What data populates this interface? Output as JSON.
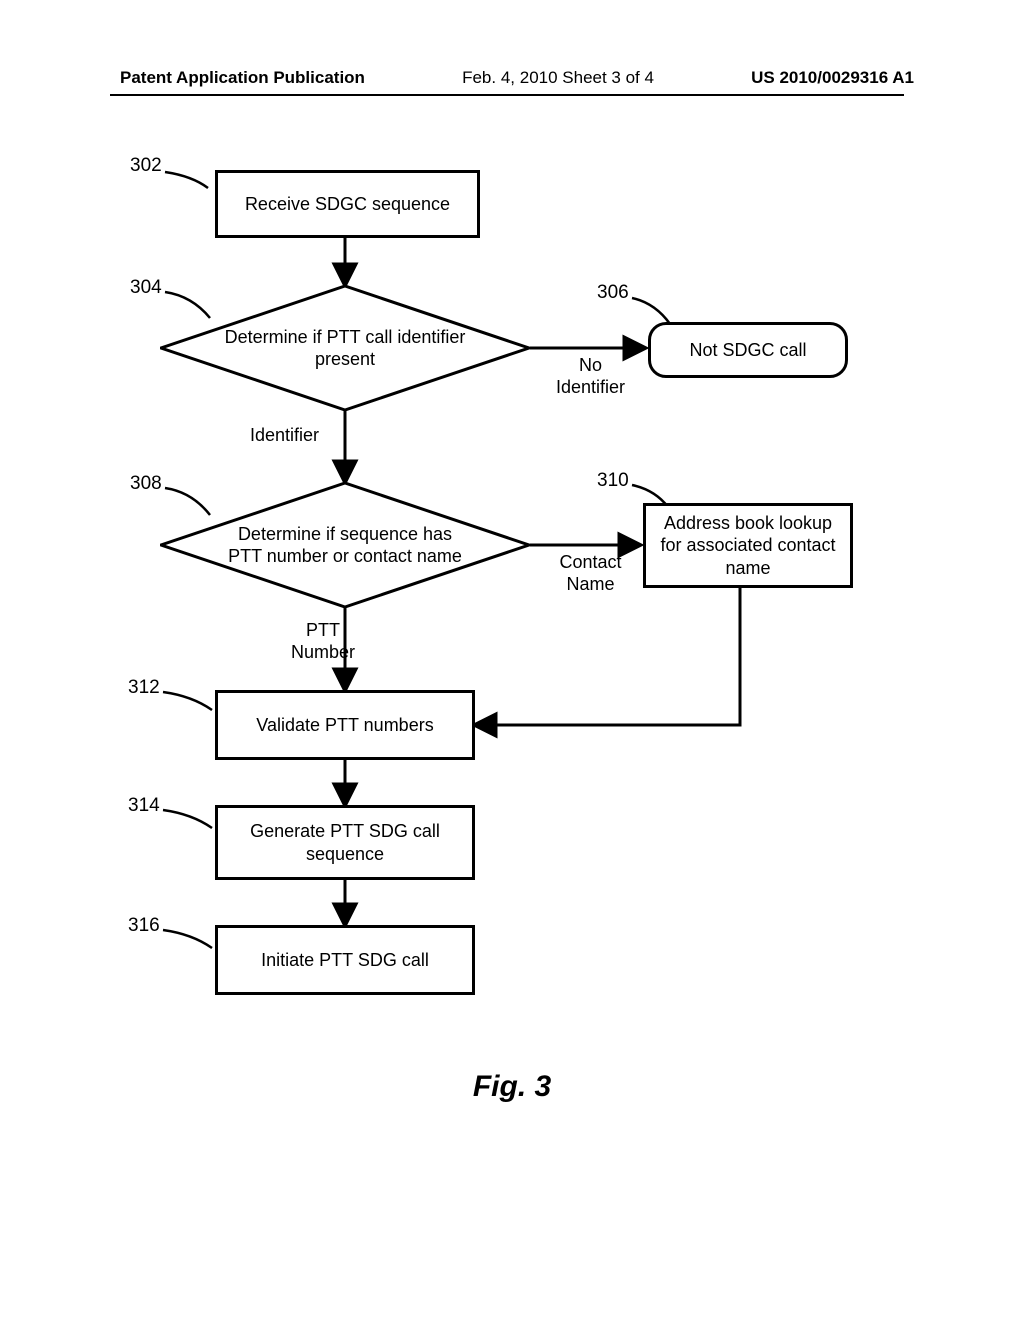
{
  "header": {
    "left": "Patent Application Publication",
    "mid": "Feb. 4, 2010  Sheet 3 of 4",
    "right": "US 2010/0029316 A1"
  },
  "refs": {
    "r302": "302",
    "r304": "304",
    "r306": "306",
    "r308": "308",
    "r310": "310",
    "r312": "312",
    "r314": "314",
    "r316": "316"
  },
  "nodes": {
    "n302": "Receive SDGC sequence",
    "n304": "Determine if PTT call identifier present",
    "n306": "Not SDGC call",
    "n308": "Determine if sequence has PTT number or contact name",
    "n310": "Address book lookup for associated contact name",
    "n312": "Validate PTT numbers",
    "n314": "Generate PTT SDG call sequence",
    "n316": "Initiate PTT SDG call"
  },
  "edges": {
    "no_identifier": "No\nIdentifier",
    "identifier": "Identifier",
    "contact_name": "Contact\nName",
    "ptt_number": "PTT\nNumber"
  },
  "figure_caption": "Fig. 3"
}
